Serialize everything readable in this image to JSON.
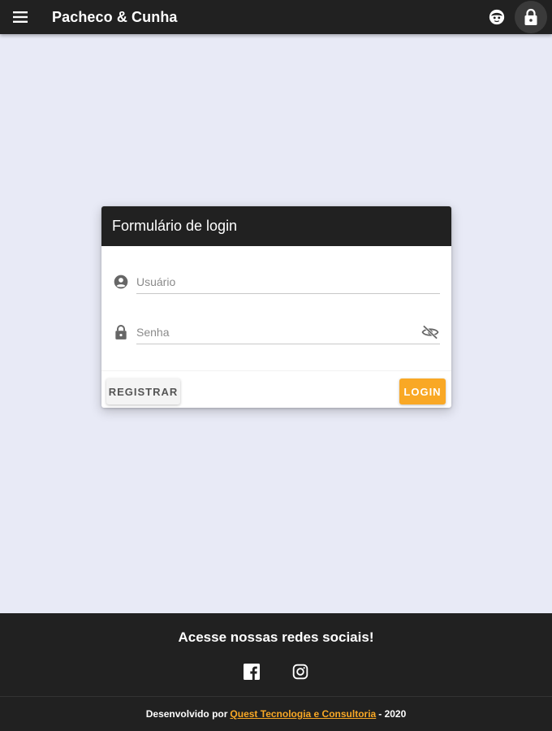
{
  "appbar": {
    "title": "Pacheco & Cunha",
    "menu_icon": "menu-icon",
    "account_icon": "account-face-icon",
    "lock_icon": "lock-icon"
  },
  "login_form": {
    "title": "Formulário de login",
    "username": {
      "placeholder": "Usuário",
      "value": "",
      "icon": "account-circle-icon"
    },
    "password": {
      "placeholder": "Senha",
      "value": "",
      "icon": "lock-icon",
      "toggle_icon": "eye-off-icon"
    },
    "register_label": "REGISTRAR",
    "login_label": "LOGIN"
  },
  "footer": {
    "title": "Acesse nossas redes sociais!",
    "social": [
      "facebook-icon",
      "instagram-icon"
    ],
    "credit_prefix": "Desenvolvido por",
    "credit_link": "Quest Tecnologia e Consultoria",
    "credit_suffix": "- 2020"
  },
  "colors": {
    "appbar": "#212121",
    "background": "#e8eaf6",
    "accent": "#f9a825",
    "footer": "#212121"
  }
}
